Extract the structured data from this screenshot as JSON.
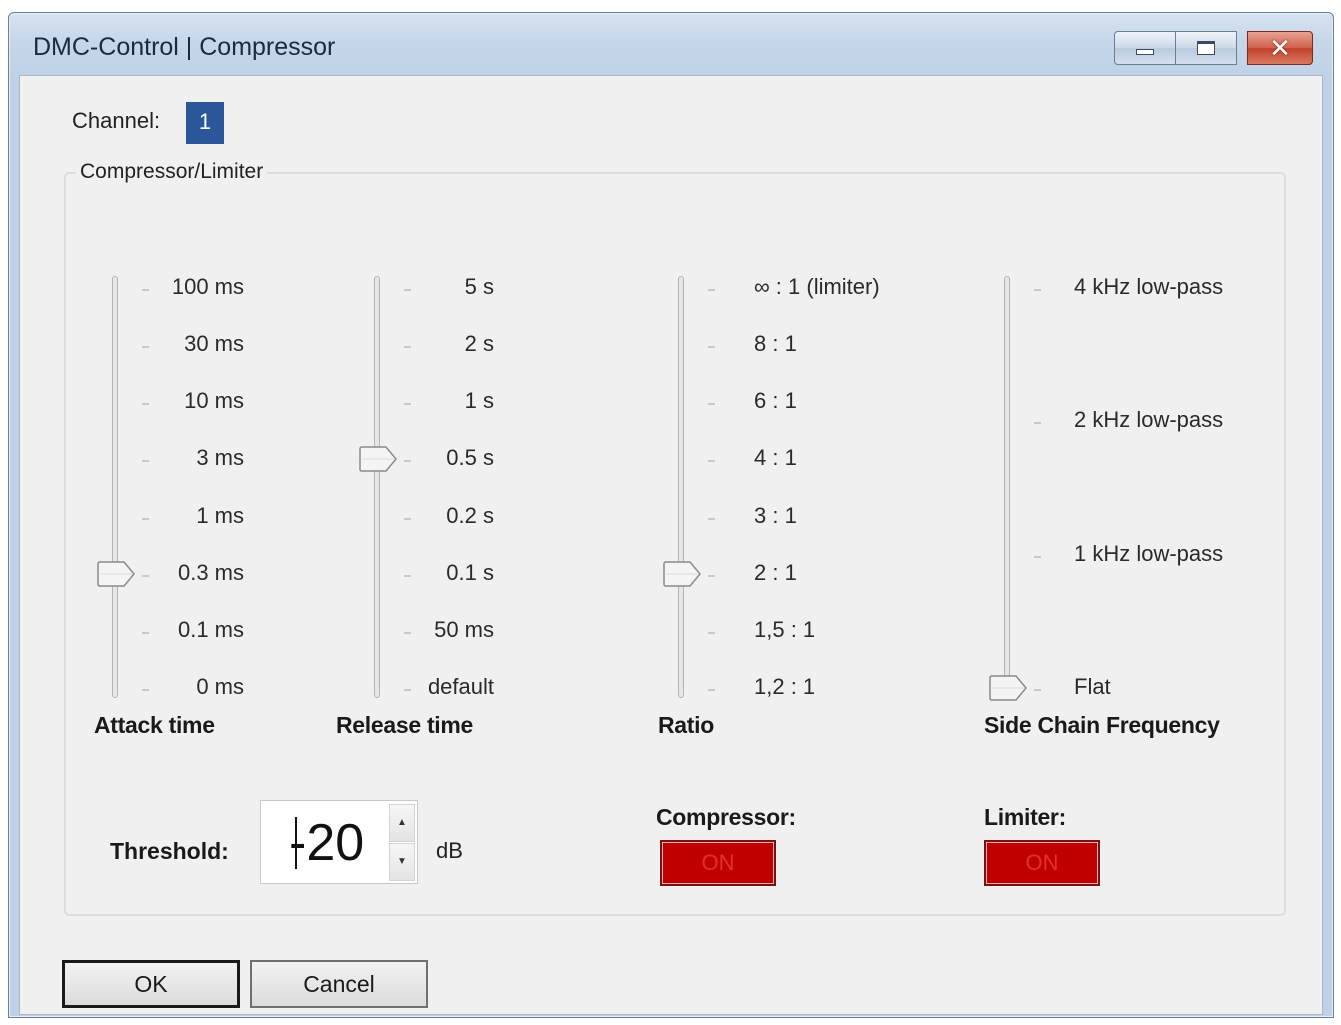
{
  "window": {
    "title": "DMC-Control | Compressor",
    "caption_buttons": {
      "minimize": "minimize-icon",
      "maximize": "maximize-icon",
      "close": "close-icon"
    }
  },
  "channel": {
    "label": "Channel:",
    "value": "1"
  },
  "group": {
    "title": "Compressor/Limiter"
  },
  "sliders": {
    "attack": {
      "title": "Attack time",
      "ticks": [
        "100 ms",
        "30 ms",
        "10 ms",
        "3 ms",
        "1 ms",
        "0.3 ms",
        "0.1 ms",
        "0 ms"
      ],
      "selected": "0.3 ms"
    },
    "release": {
      "title": "Release time",
      "ticks": [
        "5 s",
        "2 s",
        "1 s",
        "0.5 s",
        "0.2 s",
        "0.1 s",
        "50 ms",
        "default"
      ],
      "selected": "0.5 s"
    },
    "ratio": {
      "title": "Ratio",
      "ticks": [
        "∞ : 1 (limiter)",
        "8 : 1",
        "6 : 1",
        "4 : 1",
        "3 : 1",
        "2 : 1",
        "1,5 : 1",
        "1,2 : 1"
      ],
      "selected": "2 : 1"
    },
    "sidechain": {
      "title": "Side Chain Frequency",
      "ticks": [
        "4 kHz low-pass",
        "2 kHz low-pass",
        "1 kHz low-pass",
        "Flat"
      ],
      "selected": "Flat"
    }
  },
  "threshold": {
    "label": "Threshold:",
    "value": "-20",
    "unit": "dB"
  },
  "compressor": {
    "label": "Compressor:",
    "state": "ON"
  },
  "limiter": {
    "label": "Limiter:",
    "state": "ON"
  },
  "buttons": {
    "ok": "OK",
    "cancel": "Cancel"
  },
  "colors": {
    "toggle_on": "#c00000",
    "channel_badge": "#2b579a"
  }
}
